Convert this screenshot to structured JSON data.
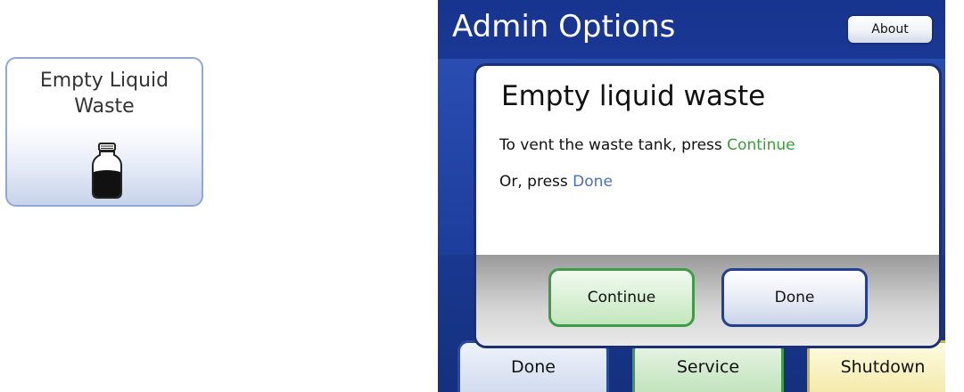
{
  "tile": {
    "label_line1": "Empty Liquid",
    "label_line2": "Waste",
    "icon": "jar-icon"
  },
  "screen": {
    "title": "Admin Options",
    "about_label": "About"
  },
  "dialog": {
    "title": "Empty liquid waste",
    "line1_prefix": "To vent the waste tank, press ",
    "line1_keyword": "Continue",
    "line2_prefix": "Or, press ",
    "line2_keyword": "Done",
    "continue_label": "Continue",
    "done_label": "Done"
  },
  "bottom_buttons": {
    "done_label": "Done",
    "service_label": "Service",
    "shutdown_label": "Shutdown"
  },
  "colors": {
    "screen_blue": "#1d3d9c",
    "continue_green": "#3a9c3a",
    "done_blue": "#4a6fc0",
    "shutdown_yellow": "#f0e49a"
  }
}
